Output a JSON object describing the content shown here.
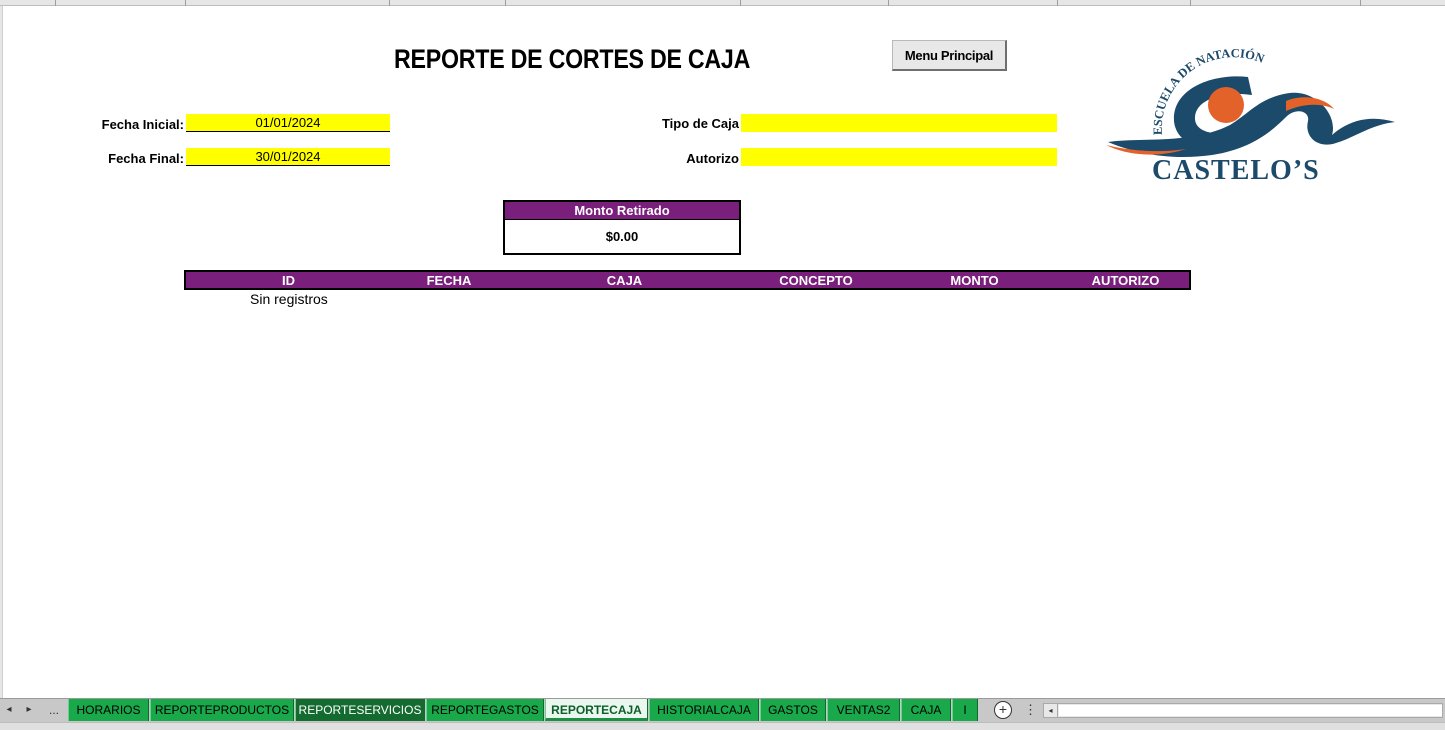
{
  "report": {
    "title": "REPORTE DE CORTES DE CAJA",
    "menu_button": "Menu Principal"
  },
  "filters": {
    "fecha_inicial_label": "Fecha Inicial:",
    "fecha_inicial_value": "01/01/2024",
    "fecha_final_label": "Fecha Final:",
    "fecha_final_value": "30/01/2024",
    "tipo_caja_label": "Tipo de Caja",
    "tipo_caja_value": "",
    "autorizo_label": "Autorizo",
    "autorizo_value": ""
  },
  "summary": {
    "header": "Monto Retirado",
    "value": "$0.00"
  },
  "table": {
    "columns": [
      "ID",
      "FECHA",
      "CAJA",
      "CONCEPTO",
      "MONTO",
      "AUTORIZO"
    ],
    "empty_message": "Sin registros"
  },
  "logo": {
    "arc_text": "ESCUELA DE NATACIÓN",
    "name": "CASTELO’S",
    "colors": {
      "navy": "#1b4a6b",
      "orange": "#e2622a"
    }
  },
  "colors": {
    "accent_purple": "#7a1f7b",
    "field_yellow": "#ffff00",
    "tab_green": "#19a84a"
  },
  "sheet_tabs": {
    "ellipsis": "...",
    "tabs": [
      "HORARIOS",
      "REPORTEPRODUCTOS",
      "REPORTESERVICIOS",
      "REPORTEGASTOS",
      "REPORTECAJA",
      "HISTORIALCAJA",
      "GASTOS",
      "VENTAS2",
      "CAJA",
      "I"
    ],
    "active": "REPORTECAJA"
  }
}
